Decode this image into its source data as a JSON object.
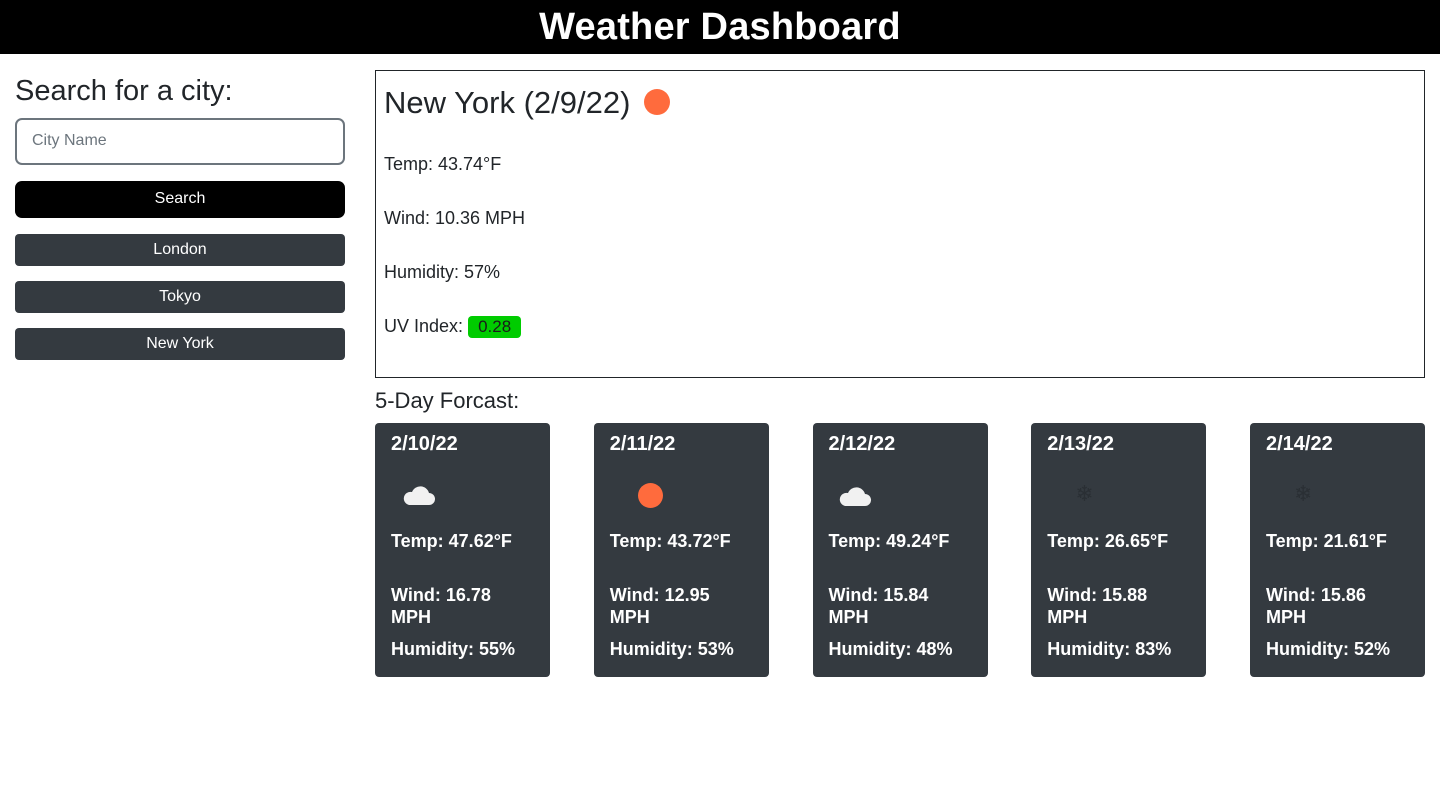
{
  "header": {
    "title": "Weather Dashboard"
  },
  "sidebar": {
    "heading": "Search for a city:",
    "search_placeholder": "City Name",
    "search_value": "",
    "search_button": "Search",
    "history": [
      "London",
      "Tokyo",
      "New York"
    ]
  },
  "current": {
    "title": "New York (2/9/22)",
    "icon": "sun-icon",
    "temp": "Temp: 43.74°F",
    "wind": "Wind: 10.36 MPH",
    "humidity": "Humidity: 57%",
    "uv_label": "UV Index:",
    "uv_value": "0.28",
    "uv_color": "#00cc00"
  },
  "forecast": {
    "title": "5-Day Forcast:",
    "days": [
      {
        "date": "2/10/22",
        "icon": "cloud-icon",
        "temp": "Temp: 47.62°F",
        "wind": "Wind: 16.78 MPH",
        "humidity": "Humidity: 55%"
      },
      {
        "date": "2/11/22",
        "icon": "sun-icon",
        "temp": "Temp: 43.72°F",
        "wind": "Wind: 12.95 MPH",
        "humidity": "Humidity: 53%"
      },
      {
        "date": "2/12/22",
        "icon": "cloudy-moon-icon",
        "temp": "Temp: 49.24°F",
        "wind": "Wind: 15.84 MPH",
        "humidity": "Humidity: 48%"
      },
      {
        "date": "2/13/22",
        "icon": "snowflake-icon",
        "temp": "Temp: 26.65°F",
        "wind": "Wind: 15.88 MPH",
        "humidity": "Humidity: 83%"
      },
      {
        "date": "2/14/22",
        "icon": "snowflake-icon",
        "temp": "Temp: 21.61°F",
        "wind": "Wind: 15.86 MPH",
        "humidity": "Humidity: 52%"
      }
    ]
  },
  "colors": {
    "sun": "#ff6b3d",
    "card_bg": "#343a40",
    "header_bg": "#000000"
  }
}
